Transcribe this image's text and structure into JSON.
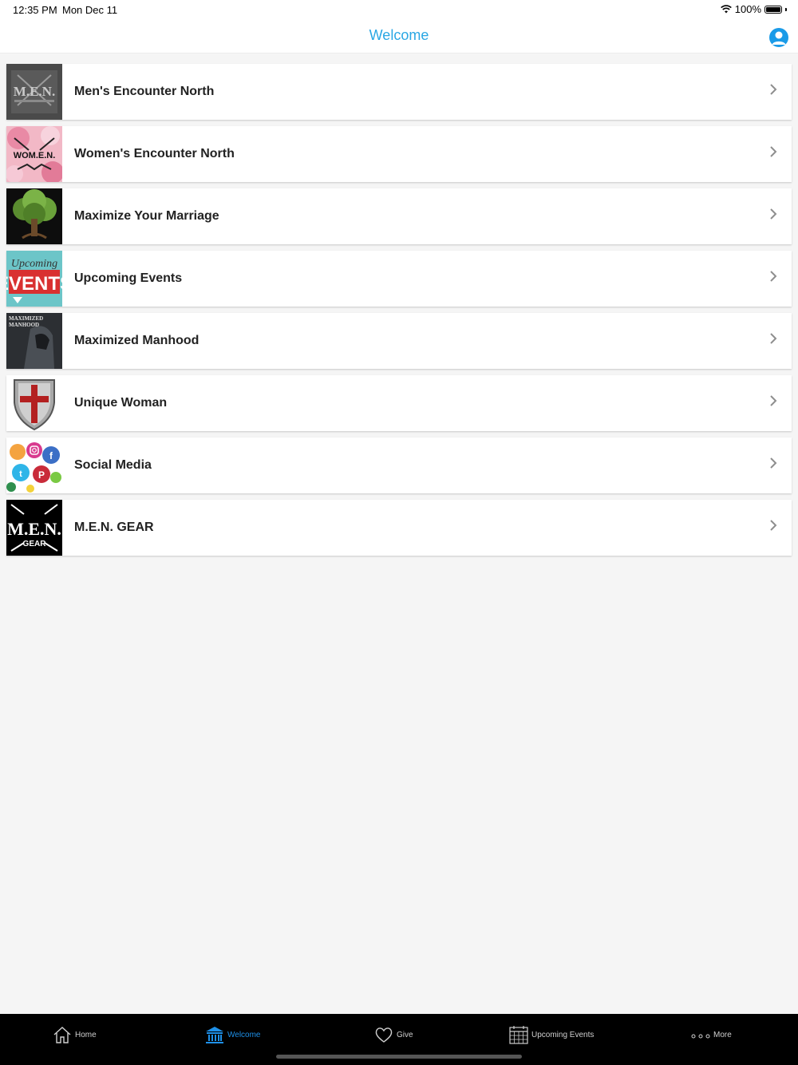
{
  "status": {
    "time": "12:35 PM",
    "date": "Mon Dec 11",
    "battery": "100%"
  },
  "nav": {
    "title": "Welcome"
  },
  "items": [
    {
      "label": "Men's Encounter North",
      "thumb_text": "M.E.N."
    },
    {
      "label": "Women's Encounter North",
      "thumb_text": "WOM.E.N."
    },
    {
      "label": "Maximize Your Marriage",
      "thumb_text": ""
    },
    {
      "label": "Upcoming Events",
      "thumb_text": "Upcoming EVENTS"
    },
    {
      "label": "Maximized Manhood",
      "thumb_text": "MAXIMIZED MANHOOD"
    },
    {
      "label": "Unique Woman",
      "thumb_text": ""
    },
    {
      "label": "Social Media",
      "thumb_text": ""
    },
    {
      "label": "M.E.N. GEAR",
      "thumb_text": "M.E.N. GEAR"
    }
  ],
  "tabs": [
    {
      "label": "Home",
      "icon": "home-icon"
    },
    {
      "label": "Welcome",
      "icon": "bank-icon",
      "active": true
    },
    {
      "label": "Give",
      "icon": "heart-icon"
    },
    {
      "label": "Upcoming Events",
      "icon": "calendar-icon"
    },
    {
      "label": "More",
      "icon": "more-icon"
    }
  ],
  "colors": {
    "accent": "#2aa7e4",
    "tab_active": "#1e90e8"
  }
}
